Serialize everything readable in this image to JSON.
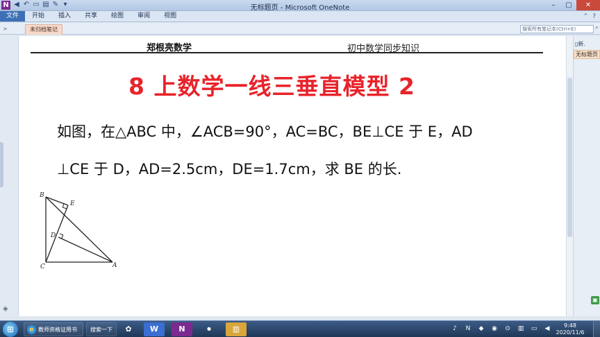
{
  "window": {
    "title": "无标题页 - Microsoft OneNote",
    "app_icon": "N",
    "controls": [
      "–",
      "▢",
      "✕"
    ]
  },
  "ribbon": {
    "file": "文件",
    "tabs": [
      "开始",
      "插入",
      "共享",
      "绘图",
      "审阅",
      "视图"
    ]
  },
  "notebook": {
    "section": "未归档笔记",
    "search_placeholder": "搜索所有笔记本(Ctrl+E)"
  },
  "page_panel": {
    "new_page": "新.",
    "page_title": "无标题页"
  },
  "content": {
    "author": "郑根亮数学",
    "course": "初中数学同步知识",
    "title": "8 上数学一线三垂直模型 2",
    "problem_line1": "如图，在△ABC 中，∠ACB=90°，AC=BC，BE⊥CE 于 E，AD",
    "problem_line2": "⊥CE 于 D，AD=2.5cm，DE=1.7cm，求 BE 的长.",
    "figure_labels": {
      "B": "B",
      "E": "E",
      "D": "D",
      "C": "C",
      "A": "A"
    }
  },
  "taskbar": {
    "ie_label": "教师资格证用书",
    "search_label": "搜索一下",
    "time": "9:48",
    "date": "2020/11/6"
  },
  "colors": {
    "title_red": "#e8232a",
    "taskbar": "#1f3857",
    "file_tab": "#3d6fb5"
  }
}
